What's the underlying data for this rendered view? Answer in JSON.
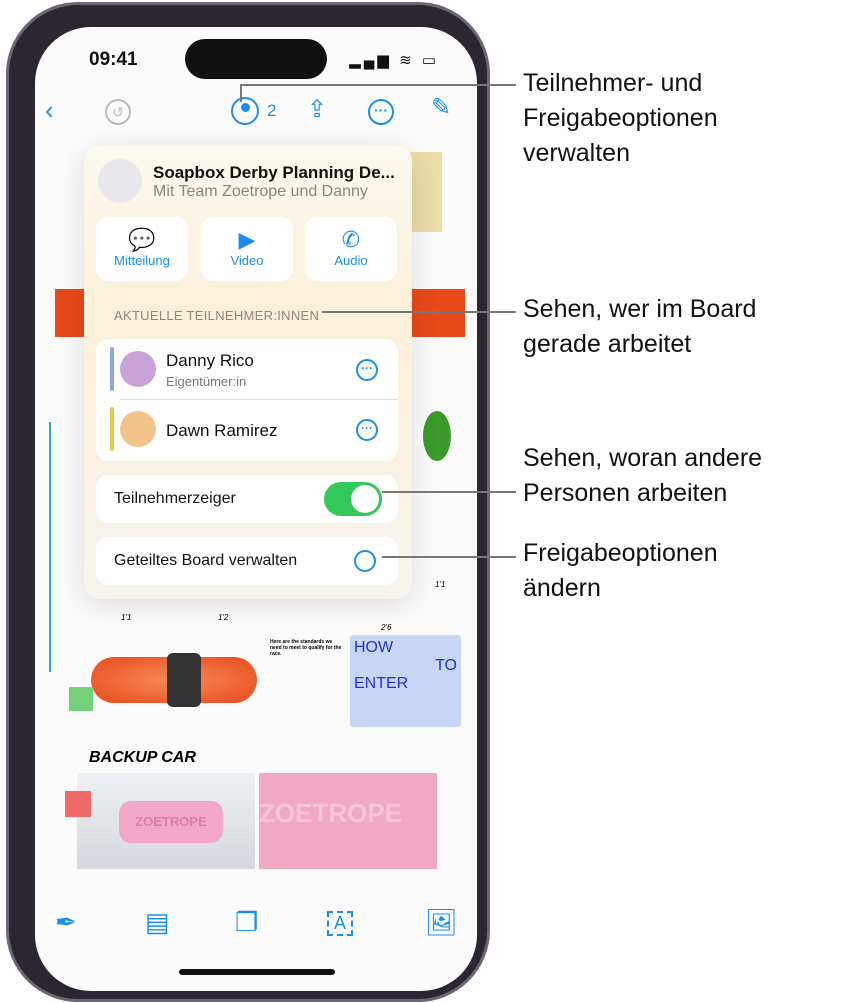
{
  "status_bar": {
    "time": "09:41"
  },
  "toolbar": {
    "participant_count": "2"
  },
  "popover": {
    "title": "Soapbox Derby Planning De...",
    "subtitle": "Mit Team Zoetrope und Danny",
    "actions": [
      {
        "label": "Mitteilung",
        "icon": "message-icon"
      },
      {
        "label": "Video",
        "icon": "video-icon"
      },
      {
        "label": "Audio",
        "icon": "phone-icon"
      }
    ],
    "section_header": "AKTUELLE TEILNEHMER:INNEN",
    "participants": [
      {
        "name": "Danny Rico",
        "role": "Eigentümer:in",
        "color": "#8aa6e6"
      },
      {
        "name": "Dawn Ramirez",
        "role": "",
        "color": "#e6c84a"
      }
    ],
    "pointer_label": "Teilnehmerzeiger",
    "pointer_on": true,
    "manage_label": "Geteiltes Board verwalten"
  },
  "board": {
    "heading": "BACKUP CAR",
    "how": "HOW",
    "to": "TO",
    "enter": "ENTER",
    "dims": [
      "1'1",
      "1'2",
      "2'6",
      "1'1"
    ],
    "text_title": "Here are the standards we need to meet to qualify for the race.",
    "zoetrope": "ZOETROPE"
  },
  "callouts": [
    "Teilnehmer- und Freigabeoptionen verwalten",
    "Sehen, wer im Board gerade arbeitet",
    "Sehen, woran andere Personen arbeiten",
    "Freigabeoptionen ändern"
  ],
  "colors": {
    "accent": "#1a8ef0",
    "toggle": "#34c759"
  }
}
